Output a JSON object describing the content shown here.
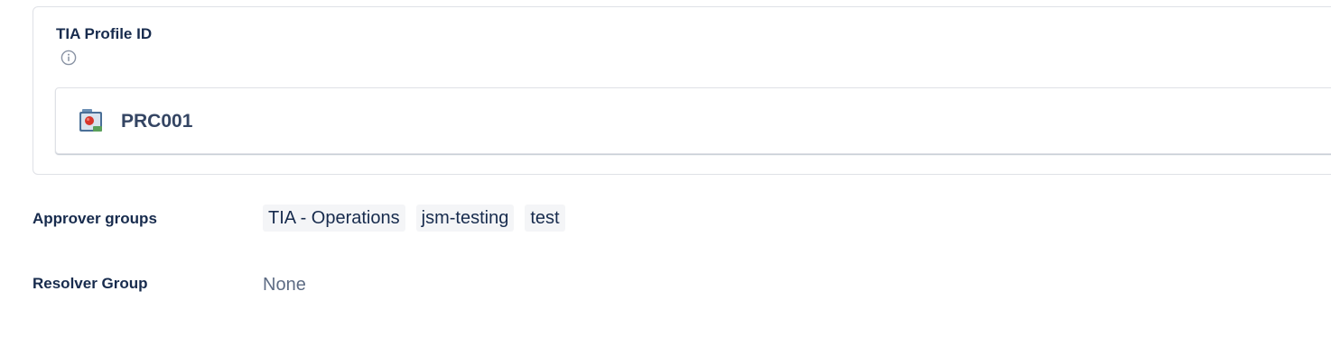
{
  "profile_field": {
    "title": "TIA Profile ID",
    "info_icon": "info-icon",
    "object": {
      "icon": "profile-object-icon",
      "key": "PRC001"
    }
  },
  "approver_groups": {
    "label": "Approver groups",
    "tags": [
      "TIA - Operations",
      "jsm-testing",
      "test"
    ]
  },
  "resolver_group": {
    "label": "Resolver Group",
    "value": "None"
  },
  "colors": {
    "text_primary": "#172b4d",
    "text_subtle": "#5e6c84",
    "tag_background": "#f4f5f7",
    "border": "#dfe1e6"
  }
}
